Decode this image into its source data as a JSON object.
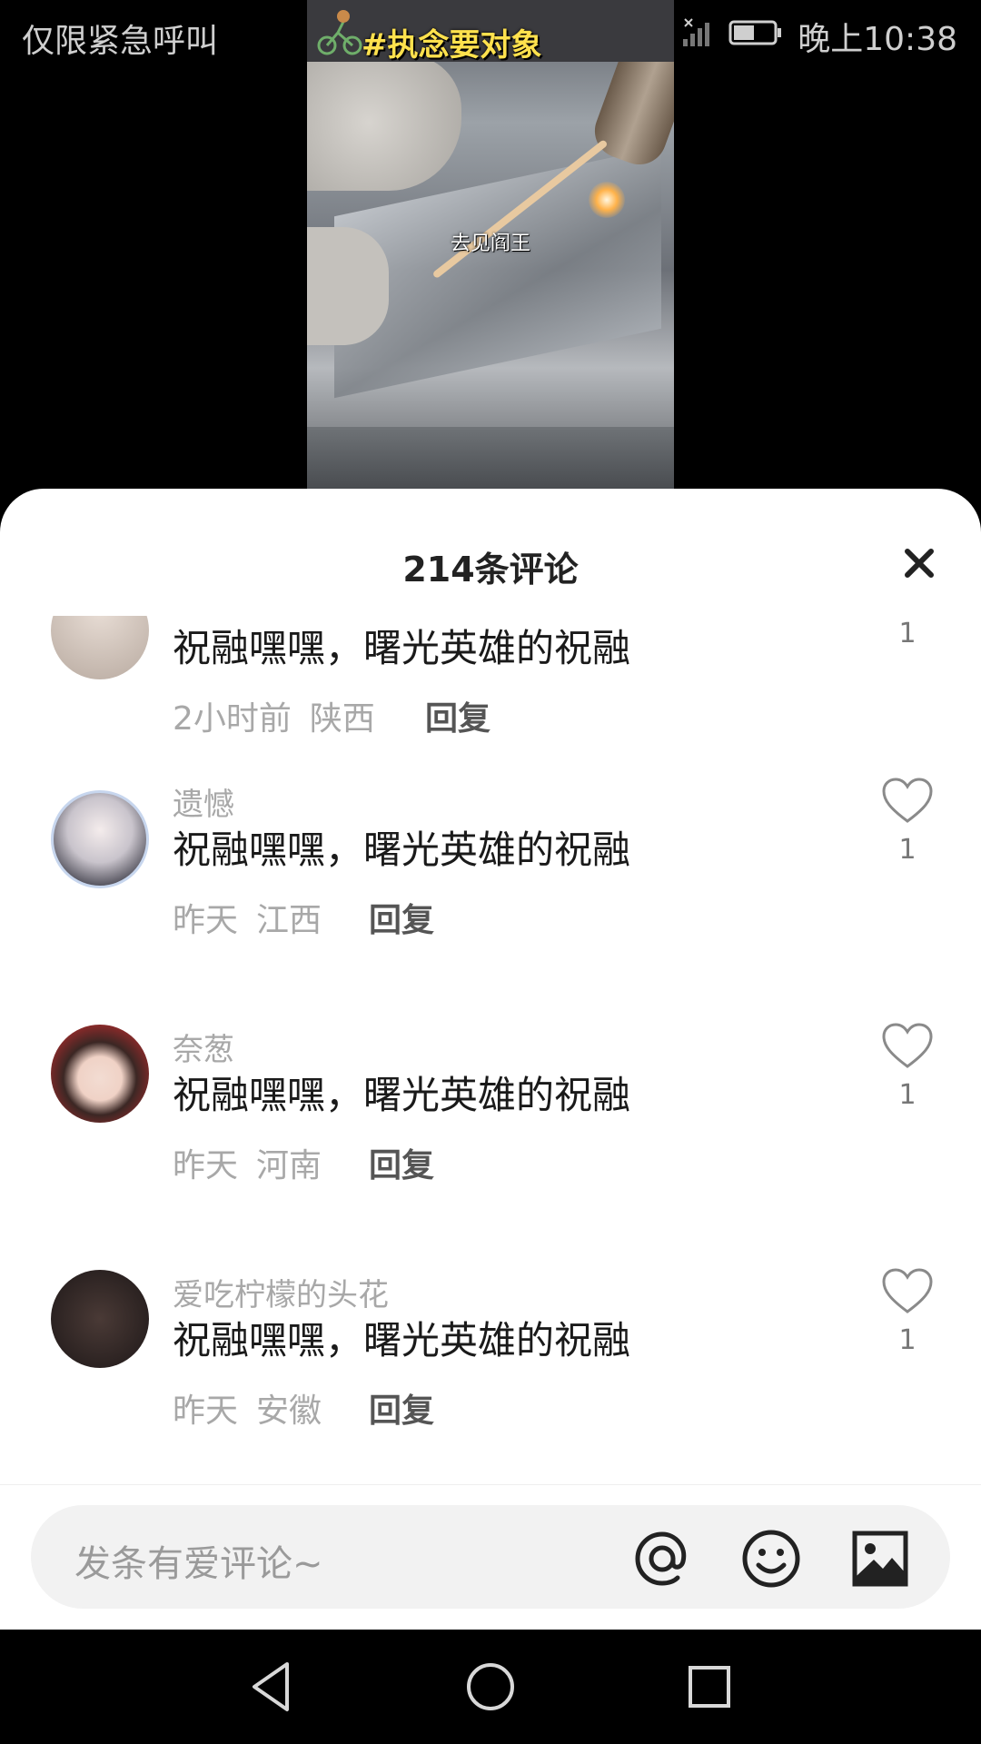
{
  "status_bar": {
    "carrier_text": "仅限紧急呼叫",
    "time": "晚上10:38"
  },
  "video": {
    "hashtag": "#执念要对象",
    "caption": "去见阎王"
  },
  "comments_sheet": {
    "title": "214条评论",
    "close_icon": "close-icon",
    "comments": [
      {
        "username": "",
        "text": "祝融嘿嘿，曙光英雄的祝融",
        "time": "2小时前",
        "location": "陕西",
        "reply_label": "回复",
        "likes": "1"
      },
      {
        "username": "遗憾",
        "text": "祝融嘿嘿，曙光英雄的祝融",
        "time": "昨天",
        "location": "江西",
        "reply_label": "回复",
        "likes": "1"
      },
      {
        "username": "奈葱",
        "text": "祝融嘿嘿，曙光英雄的祝融",
        "time": "昨天",
        "location": "河南",
        "reply_label": "回复",
        "likes": "1"
      },
      {
        "username": "爱吃柠檬的头花",
        "text": "祝融嘿嘿，曙光英雄的祝融",
        "time": "昨天",
        "location": "安徽",
        "reply_label": "回复",
        "likes": "1"
      }
    ]
  },
  "input_bar": {
    "placeholder": "发条有爱评论~",
    "icons": [
      "at-icon",
      "emoji-icon",
      "image-icon"
    ]
  },
  "nav_bar": {
    "icons": [
      "back-icon",
      "home-icon",
      "recents-icon"
    ]
  },
  "colors": {
    "sheet_bg": "#ffffff",
    "muted_text": "#a8a8a8",
    "hashtag": "#ffe14d"
  }
}
